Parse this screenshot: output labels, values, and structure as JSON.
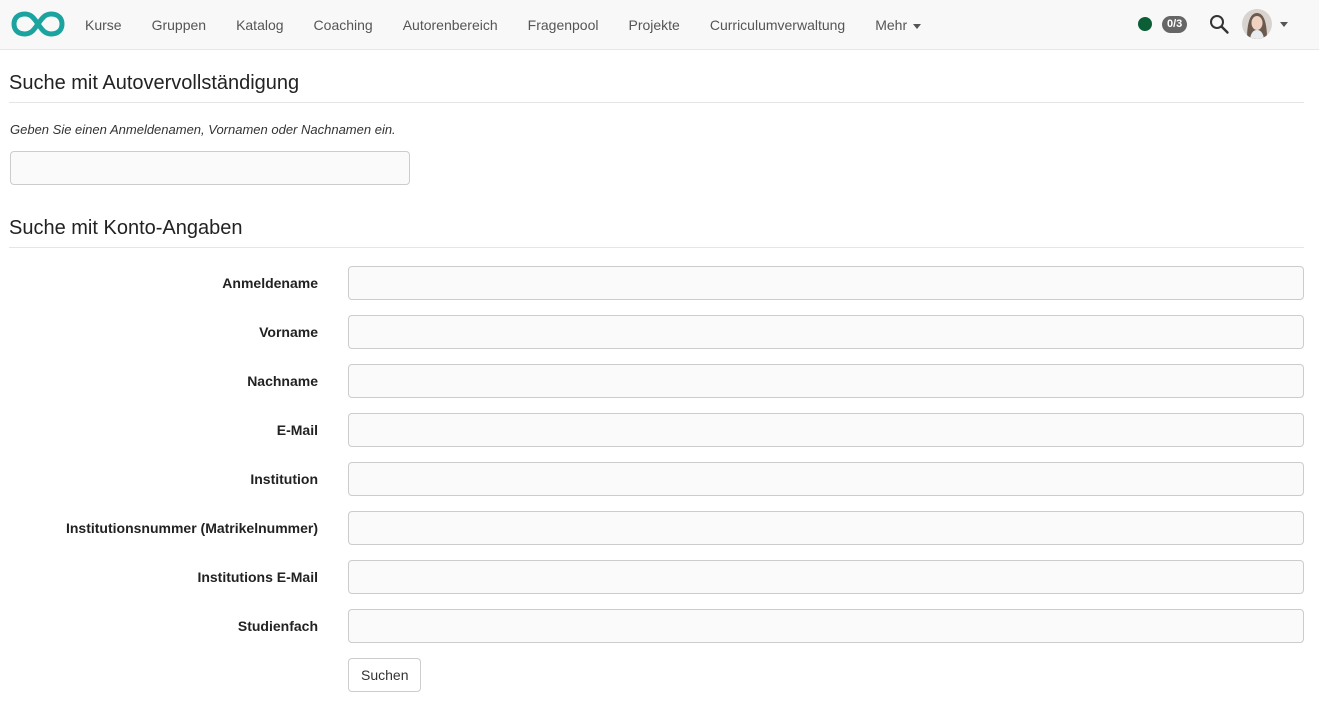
{
  "colors": {
    "brand": "#1ba3a0",
    "status_online": "#0b5e36",
    "badge_bg": "#666666",
    "navbar_bg": "#f8f8f8"
  },
  "nav": {
    "logo_icon": "infinity-logo-icon",
    "items": [
      {
        "label": "Kurse"
      },
      {
        "label": "Gruppen"
      },
      {
        "label": "Katalog"
      },
      {
        "label": "Coaching"
      },
      {
        "label": "Autorenbereich"
      },
      {
        "label": "Fragenpool"
      },
      {
        "label": "Projekte"
      },
      {
        "label": "Curriculumverwaltung"
      },
      {
        "label": "Mehr"
      }
    ],
    "counter": "0/3",
    "search_icon": "magnifier-icon"
  },
  "autocomplete": {
    "title": "Suche mit Autovervollständigung",
    "hint": "Geben Sie einen Anmeldenamen, Vornamen oder Nachnamen ein.",
    "value": ""
  },
  "account_search": {
    "title": "Suche mit Konto-Angaben",
    "fields": [
      {
        "label": "Anmeldename",
        "value": ""
      },
      {
        "label": "Vorname",
        "value": ""
      },
      {
        "label": "Nachname",
        "value": ""
      },
      {
        "label": "E-Mail",
        "value": ""
      },
      {
        "label": "Institution",
        "value": ""
      },
      {
        "label": "Institutionsnummer (Matrikelnummer)",
        "value": ""
      },
      {
        "label": "Institutions E-Mail",
        "value": ""
      },
      {
        "label": "Studienfach",
        "value": ""
      }
    ],
    "submit_label": "Suchen"
  }
}
